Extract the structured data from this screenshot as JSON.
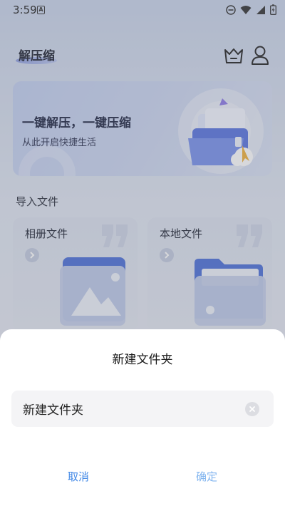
{
  "status_bar": {
    "time": "3:59",
    "notification_badge": "A"
  },
  "header": {
    "app_title": "解压缩",
    "icons": [
      "vip-crown-icon",
      "user-icon"
    ]
  },
  "banner": {
    "title": "一键解压，一键压缩",
    "subtitle": "从此开启快捷生活"
  },
  "import_section": {
    "title": "导入文件",
    "cards": [
      {
        "label": "相册文件",
        "icon": "photo-folder-icon"
      },
      {
        "label": "本地文件",
        "icon": "folder-icon"
      }
    ]
  },
  "dialog": {
    "title": "新建文件夹",
    "input_value": "新建文件夹",
    "cancel_label": "取消",
    "confirm_label": "确定"
  },
  "colors": {
    "accent": "#3f87e6",
    "confirm_disabled": "#7fb3ef"
  }
}
